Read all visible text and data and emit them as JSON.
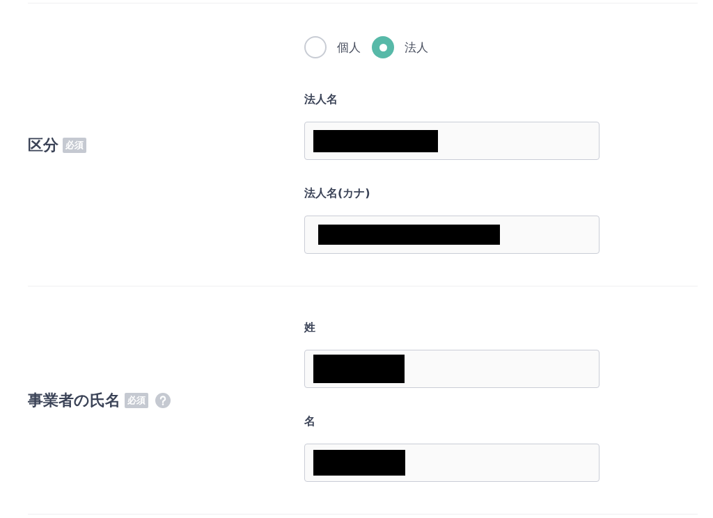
{
  "sections": [
    {
      "label": "区分",
      "required_badge": "必須",
      "help": false,
      "radios": [
        {
          "label": "個人",
          "selected": false
        },
        {
          "label": "法人",
          "selected": true
        }
      ],
      "fields": [
        {
          "label": "法人名",
          "redacted": true
        },
        {
          "label": "法人名(カナ)",
          "redacted": true
        }
      ]
    },
    {
      "label": "事業者の氏名",
      "required_badge": "必須",
      "help": true,
      "fields": [
        {
          "label": "姓",
          "redacted": true
        },
        {
          "label": "名",
          "redacted": true
        }
      ]
    }
  ]
}
